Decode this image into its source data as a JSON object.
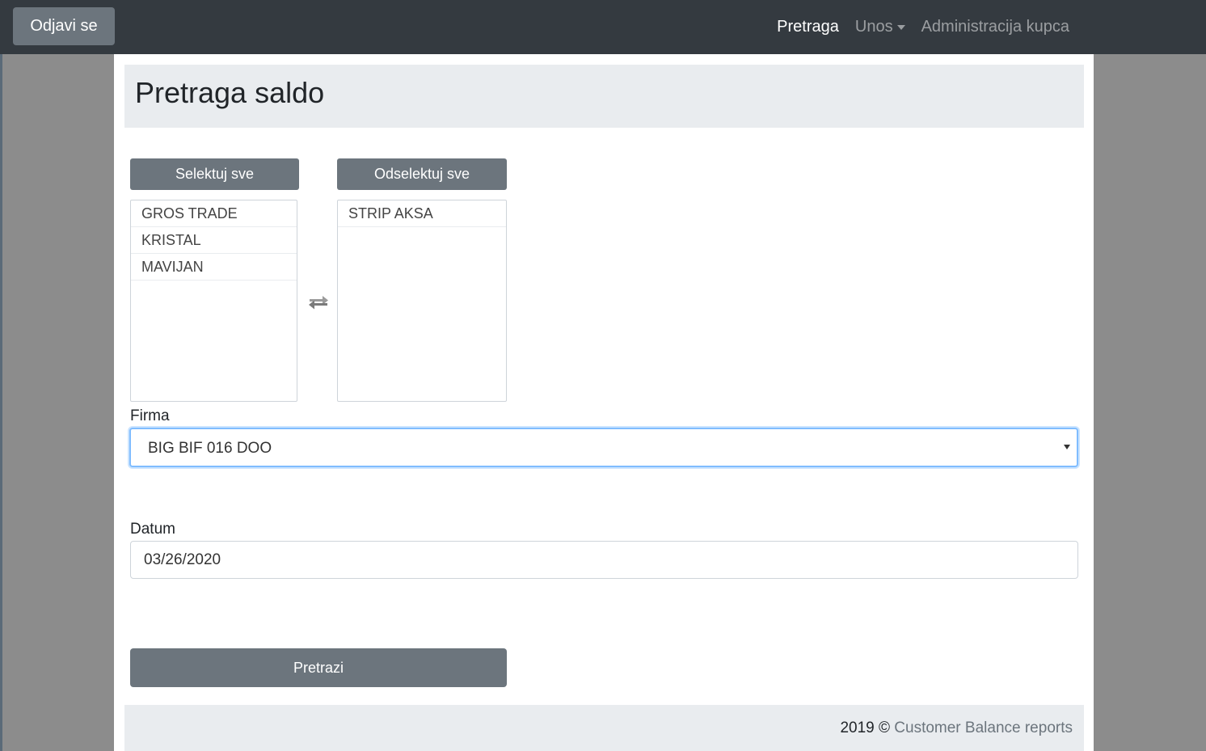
{
  "navbar": {
    "logout_label": "Odjavi se",
    "links": [
      {
        "label": "Pretraga"
      },
      {
        "label": "Unos"
      },
      {
        "label": "Administracija kupca"
      }
    ]
  },
  "page": {
    "title": "Pretraga saldo"
  },
  "picker": {
    "select_all_label": "Selektuj sve",
    "deselect_all_label": "Odselektuj sve",
    "available": [
      "GROS TRADE",
      "KRISTAL",
      "MAVIJAN"
    ],
    "selected": [
      "STRIP AKSA"
    ],
    "swap_icon": "swap-arrows-icon"
  },
  "form": {
    "firma_label": "Firma",
    "firma_value": "BIG BIF 016 DOO",
    "datum_label": "Datum",
    "datum_value": "03/26/2020",
    "search_label": "Pretrazi"
  },
  "footer": {
    "year_text": "2019 ©",
    "link_text": "Customer Balance reports"
  },
  "colors": {
    "navbar": "#343a40",
    "button": "#6c757d",
    "panel": "#e9ecef",
    "focus_border": "#80bdff"
  }
}
